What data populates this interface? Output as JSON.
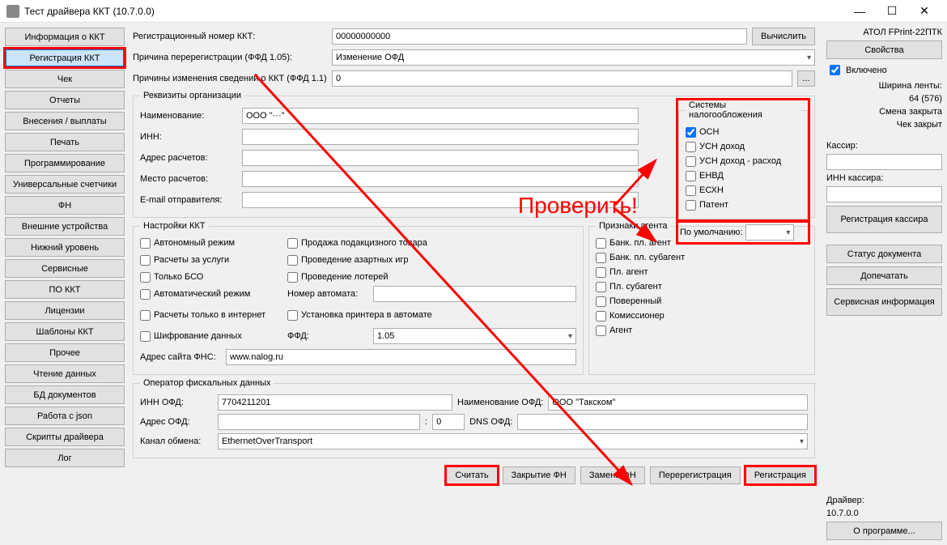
{
  "window": {
    "title": "Тест драйвера ККТ (10.7.0.0)",
    "min": "―",
    "max": "☐",
    "close": "✕"
  },
  "leftnav": [
    "Информация о ККТ",
    "Регистрация ККТ",
    "Чек",
    "Отчеты",
    "Внесения / выплаты",
    "Печать",
    "Программирование",
    "Универсальные счетчики",
    "ФН",
    "Внешние устройства",
    "Нижний уровень",
    "Сервисные",
    "ПО ККТ",
    "Лицензии",
    "Шаблоны ККТ",
    "Прочее",
    "Чтение данных",
    "БД документов",
    "Работа с json",
    "Скрипты драйвера",
    "Лог"
  ],
  "top": {
    "reg_label": "Регистрационный номер ККТ:",
    "reg_value": "00000000000",
    "calc_btn": "Вычислить",
    "rereg_label": "Причина перерегистрации (ФФД 1.05):",
    "rereg_value": "Изменение ОФД",
    "reasons_label": "Причины изменения сведений о ККТ (ФФД 1.1)",
    "reasons_value": "0",
    "dots": "..."
  },
  "org": {
    "legend": "Реквизиты организации",
    "name_l": "Наименование:",
    "name_v": "ООО \"···\"",
    "inn_l": "ИНН:",
    "inn_v": "",
    "addr_l": "Адрес расчетов:",
    "addr_v": "",
    "place_l": "Место расчетов:",
    "place_v": "",
    "email_l": "E-mail отправителя:",
    "email_v": "",
    "tax_legend": "Системы налогообложения",
    "tax_items": [
      "ОСН",
      "УСН доход",
      "УСН доход - расход",
      "ЕНВД",
      "ЕСХН",
      "Патент"
    ],
    "default_l": "По умолчанию:"
  },
  "kkt": {
    "legend": "Настройки ККТ",
    "c1": [
      "Автономный режим",
      "Расчеты за услуги",
      "Только БСО",
      "Автоматический режим",
      "Расчеты только в интернет",
      "Шифрование данных"
    ],
    "c2": [
      "Продажа подакцизного товара",
      "Проведение азартных игр",
      "Проведение лотерей"
    ],
    "auto_l": "Номер автомата:",
    "auto_v": "",
    "printer_l": "Установка принтера в автомате",
    "ffd_l": "ФФД:",
    "ffd_v": "1.05",
    "fns_l": "Адрес сайта ФНС:",
    "fns_v": "www.nalog.ru"
  },
  "agent": {
    "legend": "Признаки агента",
    "items": [
      "Банк. пл. агент",
      "Банк. пл. субагент",
      "Пл. агент",
      "Пл. субагент",
      "Поверенный",
      "Комиссионер",
      "Агент"
    ]
  },
  "ofd": {
    "legend": "Оператор фискальных данных",
    "inn_l": "ИНН ОФД:",
    "inn_v": "7704211201",
    "name_l": "Наименование ОФД:",
    "name_v": "ООО \"Такском\"",
    "addr_l": "Адрес ОФД:",
    "addr_v": "",
    "port_v": "0",
    "dns_l": "DNS ОФД:",
    "dns_v": "",
    "chan_l": "Канал обмена:",
    "chan_v": "EthernetOverTransport"
  },
  "bottom": [
    "Считать",
    "Закрытие ФН",
    "Замена ФН",
    "Перерегистрация",
    "Регистрация"
  ],
  "right": {
    "device": "АТОЛ FPrint-22ПТК",
    "props": "Свойства",
    "enabled": "Включено",
    "width_l": "Ширина ленты:",
    "width_v": "64 (576)",
    "shift": "Смена закрыта",
    "check": "Чек закрыт",
    "cashier_l": "Кассир:",
    "cinn_l": "ИНН кассира:",
    "reg_cashier": "Регистрация кассира",
    "doc_status": "Статус документа",
    "reprint": "Допечатать",
    "service": "Сервисная информация",
    "driver_l": "Драйвер:",
    "driver_v": "10.7.0.0",
    "about": "О программе..."
  },
  "annotation": "Проверить!"
}
